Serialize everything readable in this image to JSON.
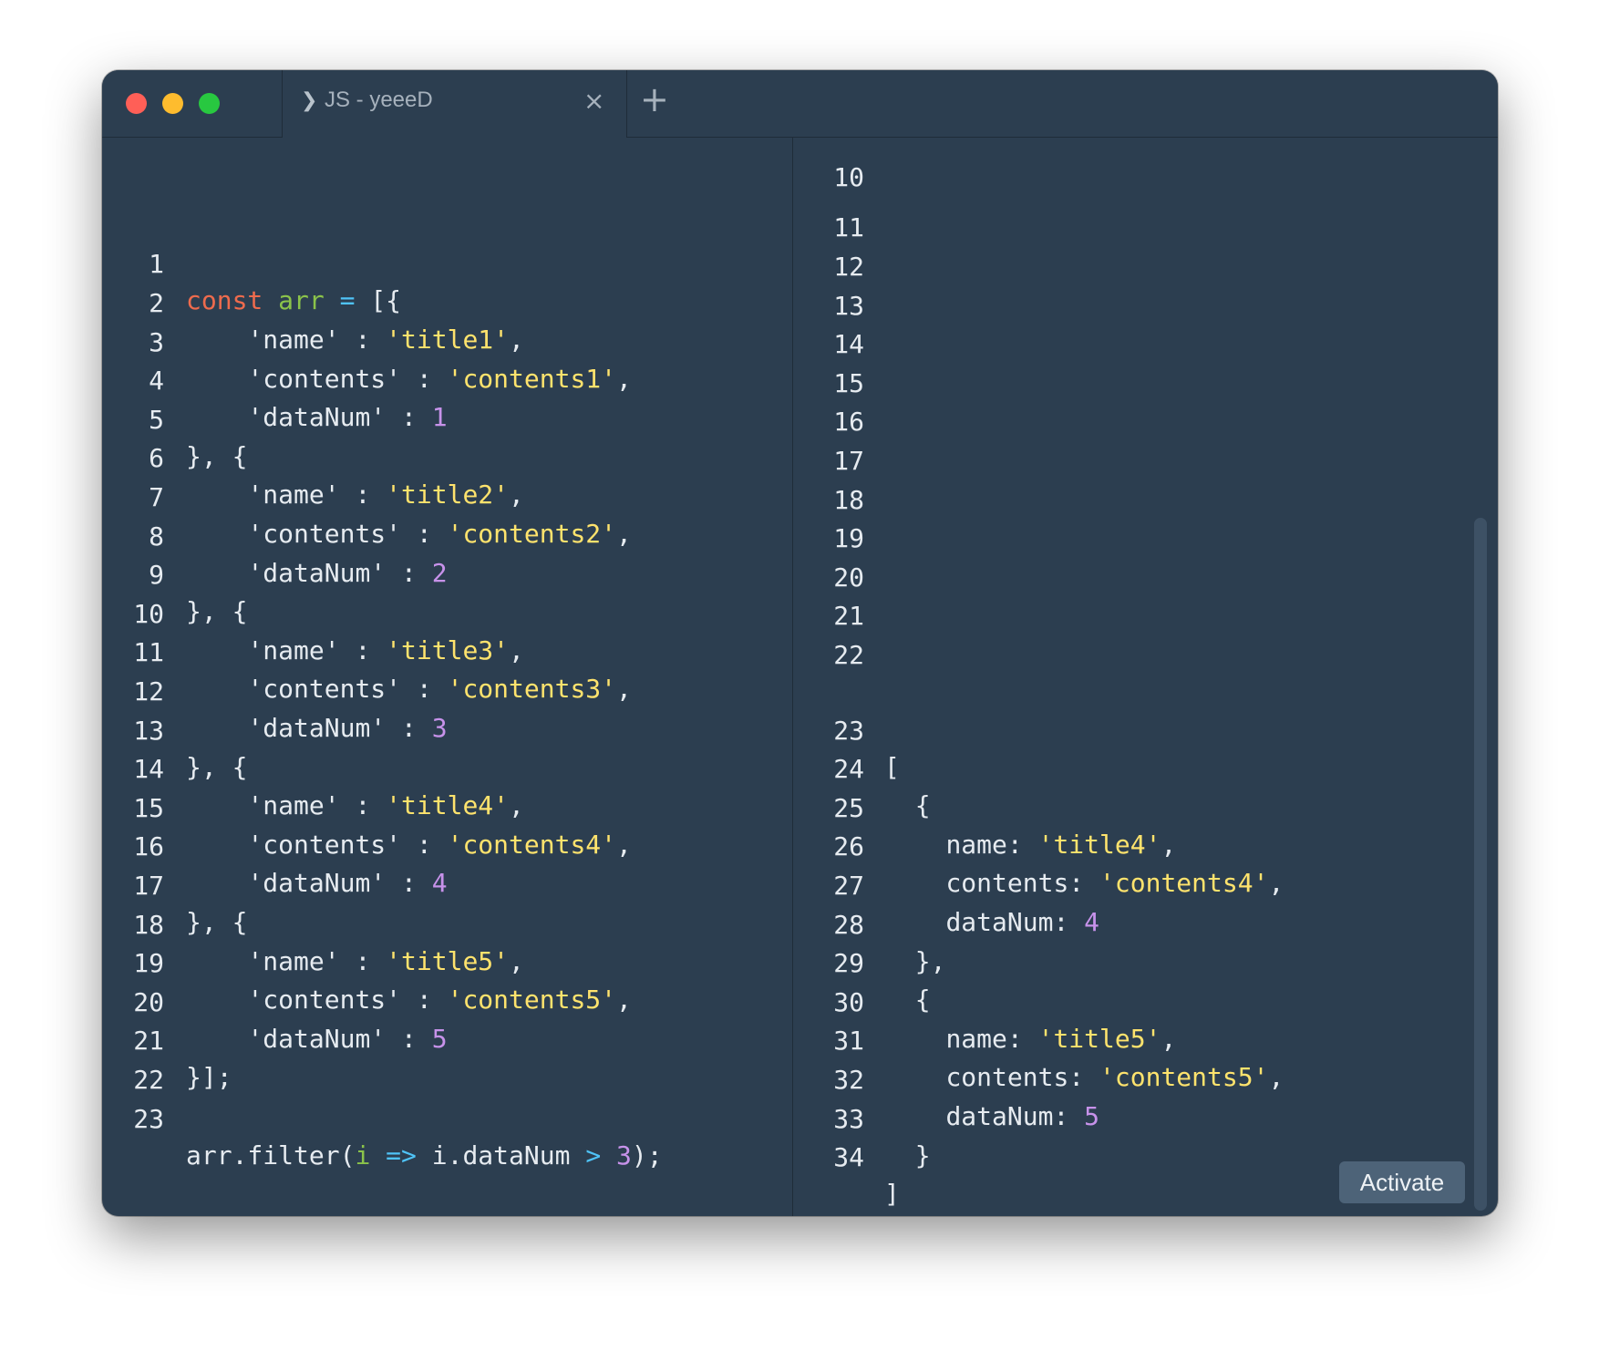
{
  "window": {
    "tab_title": "JS - yeeeD",
    "chevron_icon": "chevron-right",
    "close_icon": "×",
    "new_tab_icon": "+",
    "traffic_lights": [
      "#ff5f57",
      "#febc2e",
      "#28c840"
    ]
  },
  "left_pane": {
    "line_numbers": [
      "1",
      "2",
      "3",
      "4",
      "5",
      "6",
      "7",
      "8",
      "9",
      "10",
      "11",
      "12",
      "13",
      "14",
      "15",
      "16",
      "17",
      "18",
      "19",
      "20",
      "21",
      "22",
      "23"
    ]
  },
  "right_pane": {
    "cut_line_number": "10",
    "line_numbers": [
      "11",
      "12",
      "13",
      "14",
      "15",
      "16",
      "17",
      "18",
      "19",
      "20",
      "21",
      "22",
      "23",
      "24",
      "25",
      "26",
      "27",
      "28",
      "29",
      "30",
      "31",
      "32",
      "33",
      "34"
    ]
  },
  "code": {
    "l1": {
      "kw": "const",
      "var": "arr",
      "op": "=",
      "rest": "[{"
    },
    "l2": {
      "key": "'name' : ",
      "val": "'title1'",
      "end": ","
    },
    "l3": {
      "key": "'contents' : ",
      "val": "'contents1'",
      "end": ","
    },
    "l4": {
      "key": "'dataNum' : ",
      "val": "1"
    },
    "l5": "}, {",
    "l6": {
      "key": "'name' : ",
      "val": "'title2'",
      "end": ","
    },
    "l7": {
      "key": "'contents' : ",
      "val": "'contents2'",
      "end": ","
    },
    "l8": {
      "key": "'dataNum' : ",
      "val": "2"
    },
    "l9": "}, {",
    "l10": {
      "key": "'name' : ",
      "val": "'title3'",
      "end": ","
    },
    "l11": {
      "key": "'contents' : ",
      "val": "'contents3'",
      "end": ","
    },
    "l12": {
      "key": "'dataNum' : ",
      "val": "3"
    },
    "l13": "}, {",
    "l14": {
      "key": "'name' : ",
      "val": "'title4'",
      "end": ","
    },
    "l15": {
      "key": "'contents' : ",
      "val": "'contents4'",
      "end": ","
    },
    "l16": {
      "key": "'dataNum' : ",
      "val": "4"
    },
    "l17": "}, {",
    "l18": {
      "key": "'name' : ",
      "val": "'title5'",
      "end": ","
    },
    "l19": {
      "key": "'contents' : ",
      "val": "'contents5'",
      "end": ","
    },
    "l20": {
      "key": "'dataNum' : ",
      "val": "5"
    },
    "l21": "}];",
    "l23": {
      "a": "arr.filter(",
      "param": "i",
      "arrow": "=>",
      "b": "i.dataNum",
      "gt": ">",
      "num": "3",
      "c": ");"
    }
  },
  "output": {
    "o23": "[",
    "o24": "{",
    "o25": {
      "key": "name: ",
      "val": "'title4'",
      "end": ","
    },
    "o26": {
      "key": "contents: ",
      "val": "'contents4'",
      "end": ","
    },
    "o27": {
      "key": "dataNum: ",
      "val": "4"
    },
    "o28": "},",
    "o29": "{",
    "o30": {
      "key": "name: ",
      "val": "'title5'",
      "end": ","
    },
    "o31": {
      "key": "contents: ",
      "val": "'contents5'",
      "end": ","
    },
    "o32": {
      "key": "dataNum: ",
      "val": "5"
    },
    "o33": "}",
    "o34": "]"
  },
  "activate_label": "Activate"
}
